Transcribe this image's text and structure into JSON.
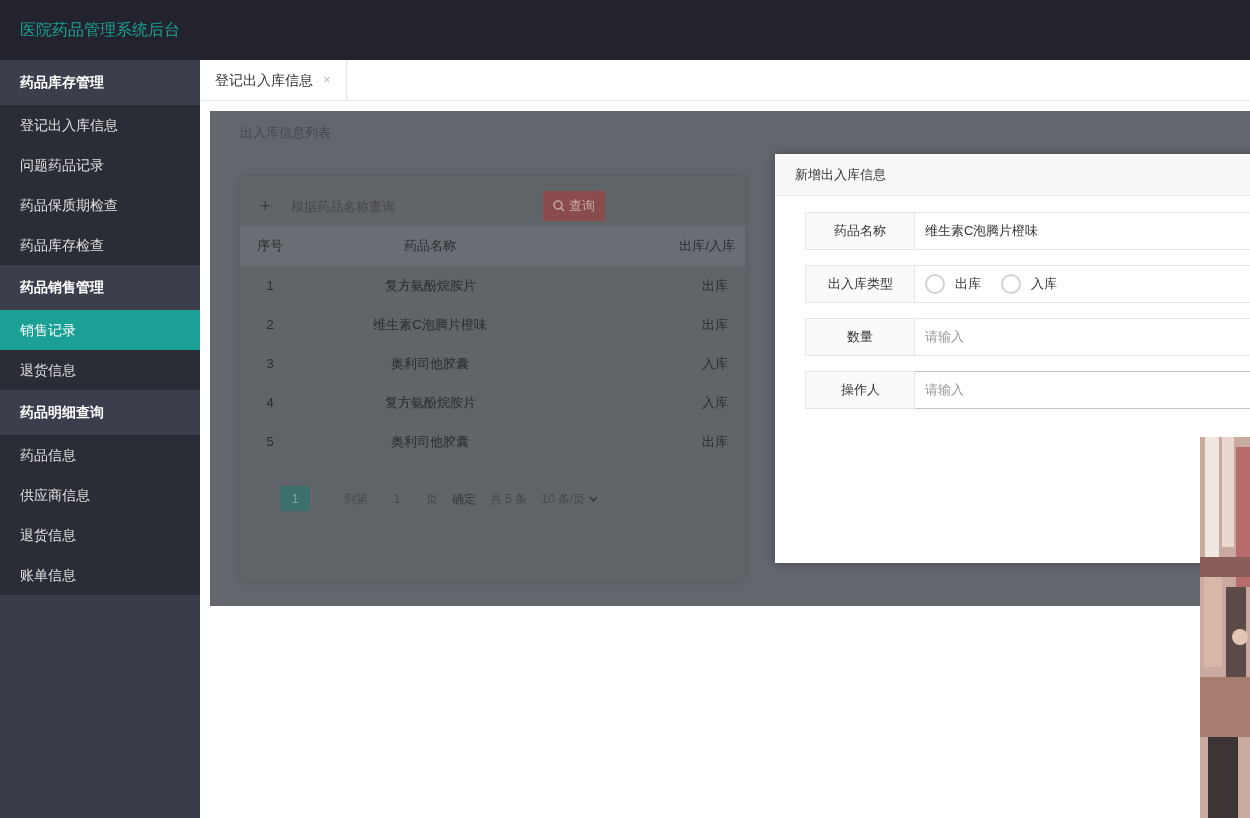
{
  "header": {
    "title": "医院药品管理系统后台"
  },
  "sidebar": {
    "groups": [
      {
        "title": "药品库存管理",
        "items": [
          {
            "label": "登记出入库信息",
            "selected": false
          },
          {
            "label": "问题药品记录",
            "selected": false
          },
          {
            "label": "药品保质期检查",
            "selected": false
          },
          {
            "label": "药品库存检查",
            "selected": false
          }
        ]
      },
      {
        "title": "药品销售管理",
        "items": [
          {
            "label": "销售记录",
            "selected": true
          },
          {
            "label": "退货信息",
            "selected": false
          }
        ]
      },
      {
        "title": "药品明细查询",
        "items": [
          {
            "label": "药品信息",
            "selected": false
          },
          {
            "label": "供应商信息",
            "selected": false
          },
          {
            "label": "退货信息",
            "selected": false
          },
          {
            "label": "账单信息",
            "selected": false
          }
        ]
      }
    ]
  },
  "tabs": [
    {
      "label": "登记出入库信息",
      "close": "×",
      "selected": true
    }
  ],
  "panel": {
    "title": "出入库信息列表",
    "add": "+",
    "search": {
      "placeholder": "根据药品名称查询"
    },
    "search_button": "查询",
    "table": {
      "columns": [
        "序号",
        "药品名称",
        "出库/入库"
      ],
      "rows": [
        [
          "1",
          "复方氨酚烷胺片",
          "出库"
        ],
        [
          "2",
          "维生素C泡腾片橙味",
          "出库"
        ],
        [
          "3",
          "奥利司他胶囊",
          "入库"
        ],
        [
          "4",
          "复方氨酚烷胺片",
          "入库"
        ],
        [
          "5",
          "奥利司他胶囊",
          "出库"
        ]
      ]
    },
    "pagination": {
      "pages": [
        {
          "label": "1",
          "selected": true
        }
      ],
      "goto_label": "到第",
      "goto_value": "1",
      "goto_suffix": "页",
      "confirm": "确定",
      "total": "共 5 条",
      "page_size": "10 条/页"
    }
  },
  "dialog": {
    "title": "新增出入库信息",
    "fields": [
      {
        "kind": "text",
        "label": "药品名称",
        "value": "维生素C泡腾片橙味"
      },
      {
        "kind": "radio",
        "label": "出入库类型",
        "options": [
          {
            "label": "出库",
            "selected": false
          },
          {
            "label": "入库",
            "selected": false
          }
        ]
      },
      {
        "kind": "text",
        "label": "数量",
        "placeholder": "请输入"
      },
      {
        "kind": "text",
        "label": "操作人",
        "placeholder": "请输入",
        "focused": true
      }
    ]
  }
}
